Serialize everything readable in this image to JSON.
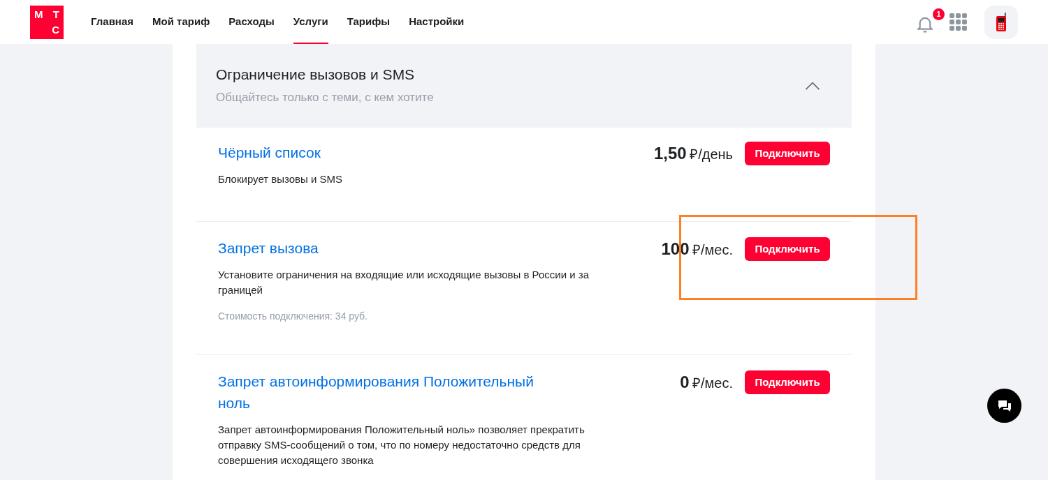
{
  "header": {
    "logo": {
      "letters": [
        "М",
        "Т",
        "С"
      ]
    },
    "nav": [
      {
        "label": "Главная",
        "selected": false
      },
      {
        "label": "Мой тариф",
        "selected": false
      },
      {
        "label": "Расходы",
        "selected": false
      },
      {
        "label": "Услуги",
        "selected": true
      },
      {
        "label": "Тарифы",
        "selected": false
      },
      {
        "label": "Настройки",
        "selected": false
      }
    ],
    "notifications_badge": "1"
  },
  "section": {
    "title": "Ограничение вызовов и SMS",
    "subtitle": "Общайтесь только с теми, с кем хотите",
    "expanded": true
  },
  "services": [
    {
      "name": "Чёрный список",
      "amount": "1,50",
      "unit": "₽/день",
      "button": "Подключить",
      "description": "Блокирует вызовы и SMS"
    },
    {
      "name": "Запрет вызова",
      "amount": "100",
      "unit": "₽/мес.",
      "button": "Подключить",
      "description": "Установите ограничения на входящие или исходящие вызовы в России и за границей",
      "note": "Стоимость подключения: 34 руб."
    },
    {
      "name": "Запрет автоинформирования Положительный ноль",
      "amount": "0",
      "unit": "₽/мес.",
      "button": "Подключить",
      "description": "Запрет автоинформирования Положительный ноль» позволяет прекратить отправку SMS-сообщений о том, что по номеру недостаточно средств для совершения исходящего звонка"
    }
  ]
}
